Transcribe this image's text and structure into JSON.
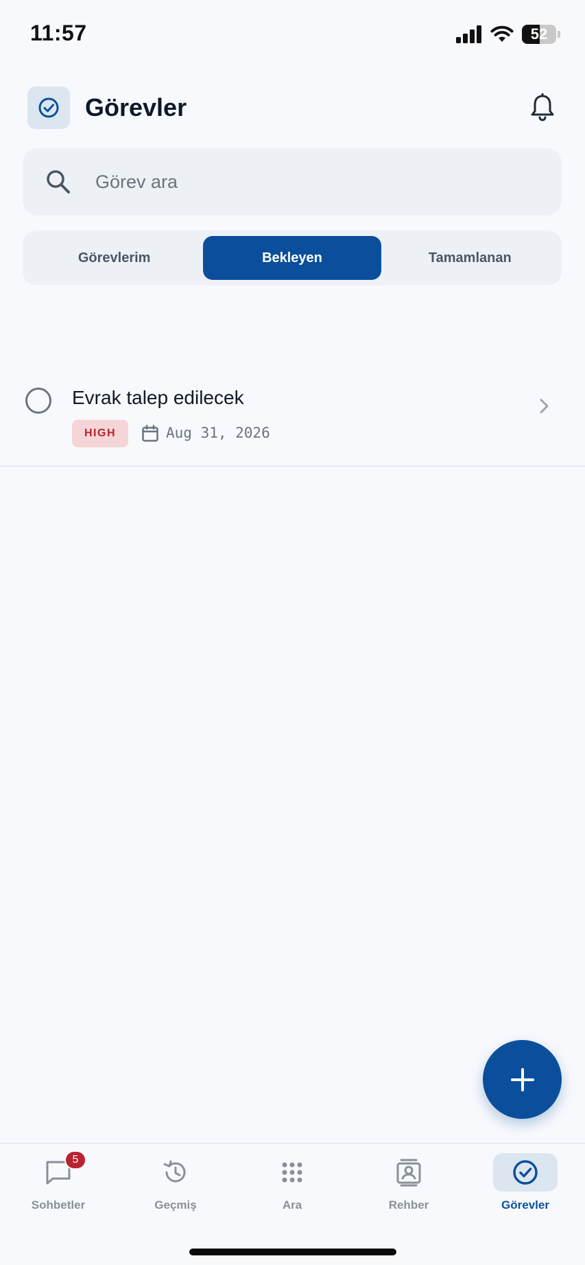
{
  "status_bar": {
    "time": "11:57",
    "battery_level": "52",
    "battery_percent": 52
  },
  "header": {
    "title": "Görevler",
    "app_icon": "check-circle-icon",
    "notification_icon": "bell-icon"
  },
  "search": {
    "placeholder": "Görev ara",
    "value": ""
  },
  "tabs": [
    {
      "label": "Görevlerim",
      "active": false
    },
    {
      "label": "Bekleyen",
      "active": true
    },
    {
      "label": "Tamamlanan",
      "active": false
    }
  ],
  "tasks": [
    {
      "title": "Evrak talep edilecek",
      "priority": "HIGH",
      "due_date": "Aug 31, 2026",
      "completed": false
    }
  ],
  "bottom_nav": {
    "items": [
      {
        "label": "Sohbetler",
        "icon": "chat-icon",
        "badge": "5",
        "active": false
      },
      {
        "label": "Geçmiş",
        "icon": "history-icon",
        "active": false
      },
      {
        "label": "Ara",
        "icon": "dialpad-icon",
        "active": false
      },
      {
        "label": "Rehber",
        "icon": "contacts-icon",
        "active": false
      },
      {
        "label": "Görevler",
        "icon": "check-circle-icon",
        "active": true
      }
    ]
  },
  "colors": {
    "accent": "#0b4f9c",
    "priority_high_bg": "#f5d5d7",
    "priority_high_text": "#b8232f",
    "background": "#f7f9fc"
  }
}
